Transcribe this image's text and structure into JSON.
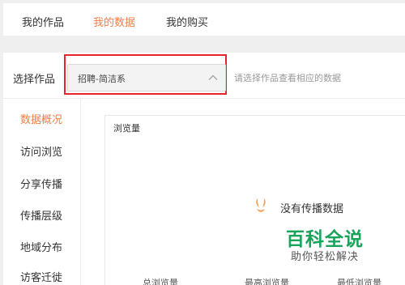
{
  "top_tabs": [
    {
      "label": "我的作品"
    },
    {
      "label": "我的数据"
    },
    {
      "label": "我的购买"
    }
  ],
  "selector": {
    "label": "选择作品",
    "value": "招聘-简洁系",
    "hint": "请选择作品查看相应的数据"
  },
  "sidebar": {
    "items": [
      {
        "label": "数据概况"
      },
      {
        "label": "访问浏览"
      },
      {
        "label": "分享传播"
      },
      {
        "label": "传播层级"
      },
      {
        "label": "地域分布"
      },
      {
        "label": "访客迁徙"
      }
    ]
  },
  "card": {
    "title": "浏览量",
    "empty_text": "没有传播数据",
    "stats": [
      {
        "label": "总浏览量"
      },
      {
        "label": "最高浏览量"
      },
      {
        "label": "最低浏览量"
      }
    ]
  },
  "watermark": {
    "title": "百科全说",
    "subtitle": "助你轻松解决"
  },
  "colors": {
    "accent": "#f57c45",
    "highlight_box": "#e8242a",
    "watermark_green": "#1aa35a"
  }
}
